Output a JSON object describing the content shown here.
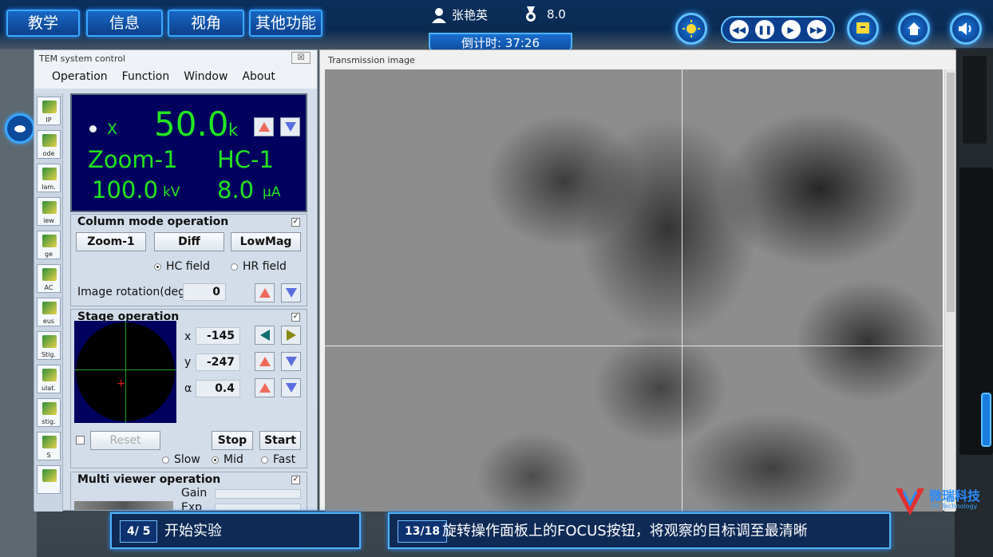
{
  "topbar": {
    "tabs": [
      "教学",
      "信息",
      "视角",
      "其他功能"
    ],
    "user_name": "张艳英",
    "score": "8.0",
    "timer": "倒计时: 37:26"
  },
  "tem": {
    "title": "TEM system control",
    "close_label": "☒",
    "menu": [
      "Operation",
      "Function",
      "Window",
      "About"
    ],
    "tools": [
      "IP",
      "ode",
      "lam.",
      "iew",
      "ge",
      "AC",
      "eus",
      "Stig.",
      "ulat.",
      "stig.",
      "S",
      ""
    ],
    "display": {
      "x_label": "X",
      "magnification": "50.0",
      "mag_unit": "k",
      "mode": "Zoom-1",
      "field": "HC-1",
      "voltage": "100.0",
      "voltage_unit": "kV",
      "current": "8.0",
      "current_unit": "μA"
    },
    "column_mode": {
      "title": "Column mode operation",
      "buttons": [
        "Zoom-1",
        "Diff",
        "LowMag"
      ],
      "radio_hc": "HC field",
      "radio_hr": "HR field",
      "rotation_label": "Image rotation(deg)",
      "rotation_value": "0"
    },
    "stage": {
      "title": "Stage operation",
      "x_label": "x",
      "x_value": "-145",
      "y_label": "y",
      "y_value": "-247",
      "a_label": "α",
      "a_value": "0.4",
      "reset_label": "Reset",
      "stop_label": "Stop",
      "start_label": "Start",
      "speed_slow": "Slow",
      "speed_mid": "Mid",
      "speed_fast": "Fast"
    },
    "multi_viewer": {
      "title": "Multi viewer operation",
      "gain_label": "Gain",
      "exp_label": "Exp"
    }
  },
  "transmission": {
    "title": "Transmission image"
  },
  "bottom": {
    "left_step": "4/ 5",
    "left_text": "开始实验",
    "right_step": "13/18",
    "right_text": "旋转操作面板上的FOCUS按钮，将观察的目标调至最清晰"
  },
  "brand": {
    "name": "微瑞科技",
    "sub": "VR Technology"
  },
  "colors": {
    "accent": "#3aa8ff",
    "display_bg": "#00005e",
    "display_text": "#22e622"
  }
}
